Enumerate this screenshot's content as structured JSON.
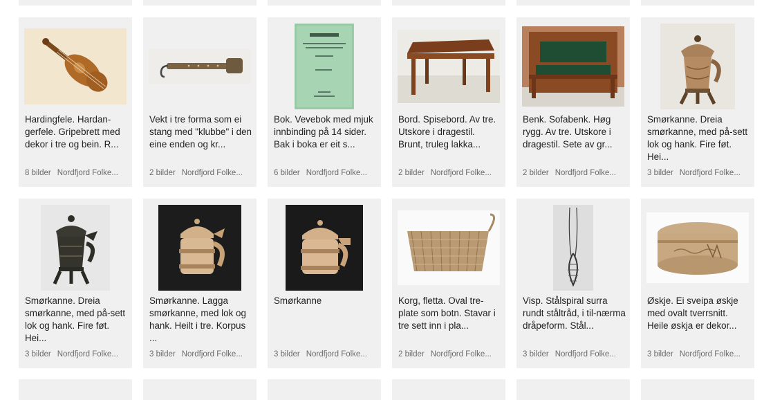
{
  "items": [
    {
      "title": "Hardingfele. Hardan-gerfele. Gripebrett med dekor i tre og bein. R...",
      "count": "8 bilder",
      "source": "Nordfjord Folke..."
    },
    {
      "title": "Vekt i tre forma som ei stang med \"klubbe\" i den eine enden og kr...",
      "count": "2 bilder",
      "source": "Nordfjord Folke..."
    },
    {
      "title": "Bok. Vevebok med mjuk innbinding på 14 sider. Bak i boka er eit s...",
      "count": "6 bilder",
      "source": "Nordfjord Folke..."
    },
    {
      "title": "Bord. Spisebord. Av tre. Utskore i dragestil. Brunt, truleg lakka...",
      "count": "2 bilder",
      "source": "Nordfjord Folke..."
    },
    {
      "title": "Benk. Sofabenk. Høg rygg. Av tre. Utskore i dragestil. Sete av gr...",
      "count": "2 bilder",
      "source": "Nordfjord Folke..."
    },
    {
      "title": "Smørkanne. Dreia smørkanne, med på-sett lok og hank. Fire føt. Hei...",
      "count": "3 bilder",
      "source": "Nordfjord Folke..."
    },
    {
      "title": "Smørkanne. Dreia smørkanne, med på-sett lok og hank. Fire føt. Hei...",
      "count": "3 bilder",
      "source": "Nordfjord Folke..."
    },
    {
      "title": "Smørkanne. Lagga smørkanne, med lok og hank. Heilt i tre. Korpus ...",
      "count": "3 bilder",
      "source": "Nordfjord Folke..."
    },
    {
      "title": "Smørkanne",
      "count": "3 bilder",
      "source": "Nordfjord Folke..."
    },
    {
      "title": "Korg, fletta. Oval tre-plate som botn. Stavar i tre sett inn i pla...",
      "count": "2 bilder",
      "source": "Nordfjord Folke..."
    },
    {
      "title": "Visp. Stålspiral surra rundt ståltråd, i til-nærma dråpeform. Stål...",
      "count": "3 bilder",
      "source": "Nordfjord Folke..."
    },
    {
      "title": "Øskje. Ei sveipa øskje med ovalt tverrsnitt. Heile øskja er dekor...",
      "count": "3 bilder",
      "source": "Nordfjord Folke..."
    }
  ]
}
